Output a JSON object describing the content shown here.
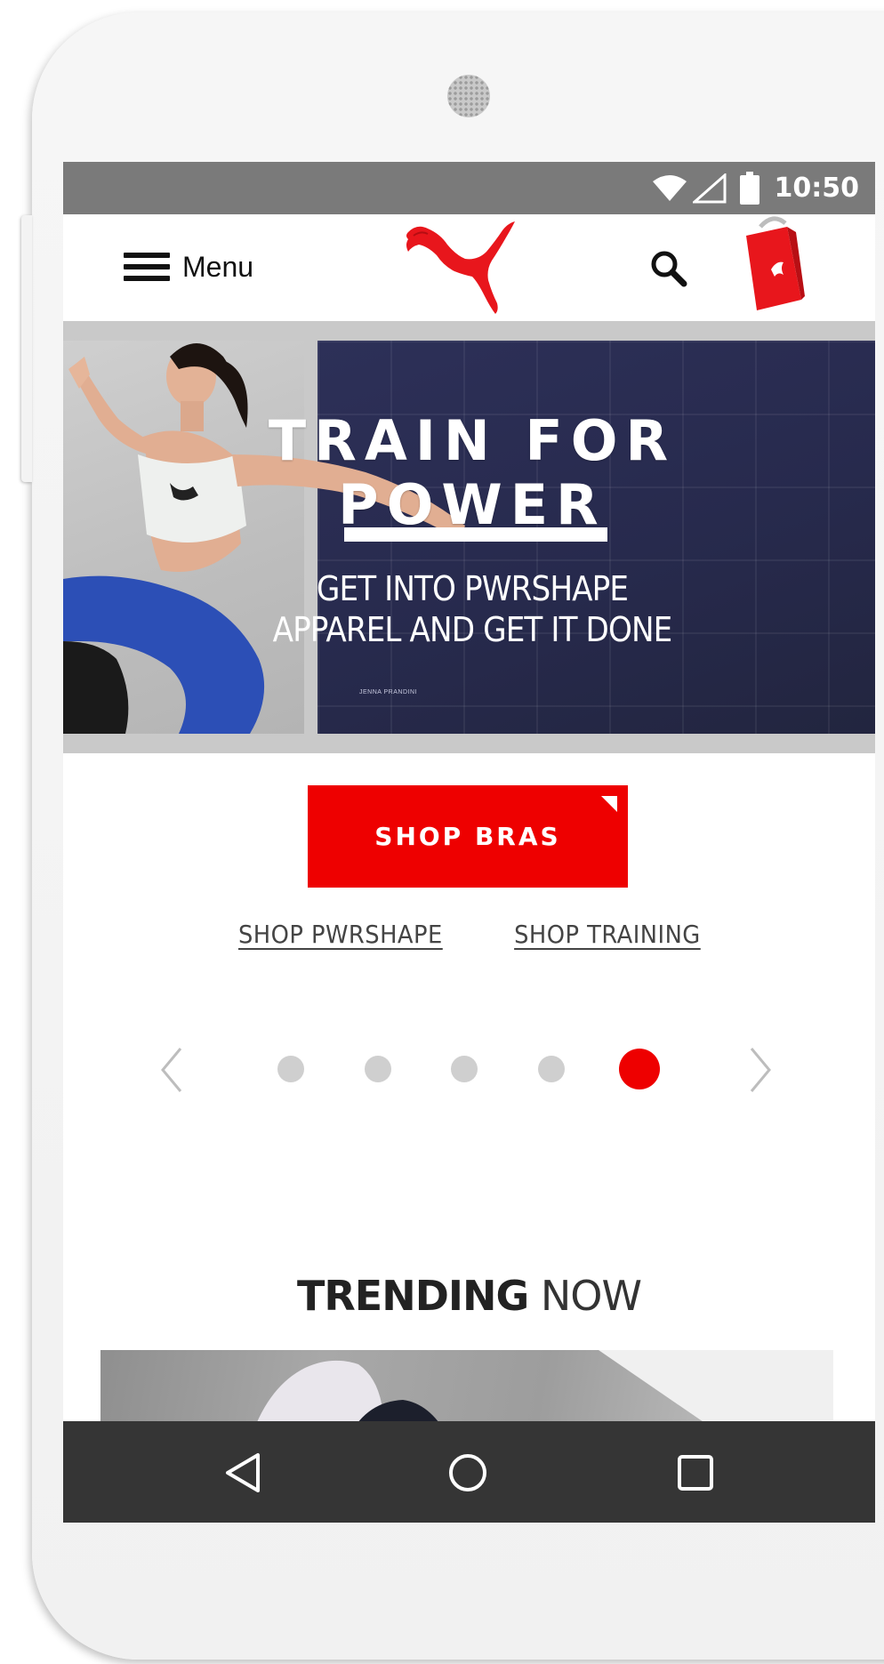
{
  "status_bar": {
    "time": "10:50",
    "icons": [
      "wifi-icon",
      "signal-icon",
      "battery-icon"
    ]
  },
  "header": {
    "menu_label": "Menu",
    "logo": "puma-logo",
    "icons": [
      "menu-icon",
      "search-icon",
      "cart-bag-icon"
    ]
  },
  "hero": {
    "title_line1": "TRAIN FOR",
    "title_line2": "POWER",
    "subtitle_line1": "GET INTO PWRSHAPE",
    "subtitle_line2": "APPAREL AND GET IT DONE",
    "credit": "JENNA PRANDINI"
  },
  "cta": {
    "primary_label": "SHOP BRAS",
    "links": [
      "SHOP PWRSHAPE",
      "SHOP TRAINING"
    ]
  },
  "carousel": {
    "slide_count": 5,
    "active_index": 4,
    "icons": [
      "chevron-left-icon",
      "chevron-right-icon"
    ]
  },
  "trending": {
    "title_bold": "TRENDING",
    "title_light": "NOW"
  },
  "nav_bar": {
    "icons": [
      "back-icon",
      "home-icon",
      "recent-apps-icon"
    ]
  },
  "colors": {
    "accent": "#EE0000",
    "status_bar": "#7A7A7A",
    "nav_bar": "#353535",
    "dot_inactive": "#CFCFCF"
  }
}
